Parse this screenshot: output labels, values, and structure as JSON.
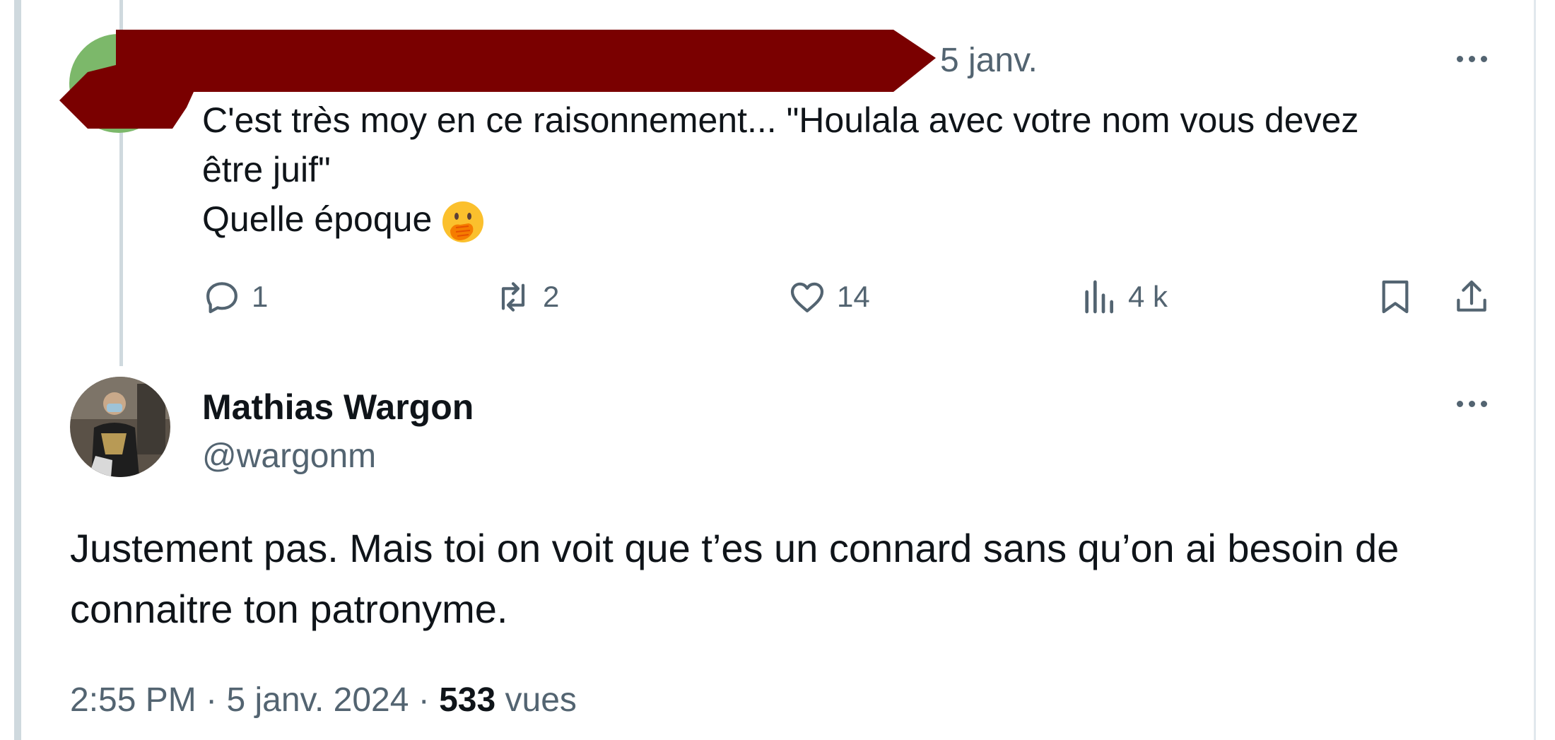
{
  "parent_tweet": {
    "date": "5 janv.",
    "text_lines": [
      "C'est très moy en ce raisonnement... \"Houlala avec votre nom vous devez",
      "être juif\"",
      "Quelle époque"
    ],
    "emoji": "face-with-hand-over-mouth",
    "actions": {
      "replies": "1",
      "retweets": "2",
      "likes": "14",
      "views": "4 k"
    }
  },
  "reply_tweet": {
    "author_name": "Mathias Wargon",
    "author_handle": "@wargonm",
    "text": "Justement pas. Mais toi on voit que t’es un connard sans qu’on ai besoin de connaitre ton patronyme.",
    "time": "2:55 PM",
    "date": "5 janv. 2024",
    "separator": "·",
    "views_count": "533",
    "views_label": "vues"
  },
  "icons": {
    "reply": "reply-icon",
    "retweet": "retweet-icon",
    "like": "heart-icon",
    "views": "views-chart-icon",
    "bookmark": "bookmark-icon",
    "share": "share-icon",
    "more": "more-dots-icon"
  },
  "colors": {
    "text_primary": "#0f1419",
    "text_secondary": "#536471",
    "redaction": "#7a0000",
    "thread_line": "#cfd9de"
  }
}
